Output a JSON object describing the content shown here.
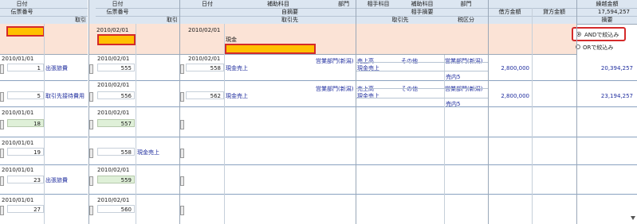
{
  "pane1": {
    "header": {
      "date": "日付",
      "slip_no": "伝票番号",
      "vendor_short": "取引"
    },
    "rows": [
      {
        "date": "2010/01/01",
        "no": "1",
        "desc": "出張旅費"
      },
      {
        "date": "",
        "no": "5",
        "desc": "取引先接待費用"
      },
      {
        "date": "2010/01/01",
        "no": "18",
        "desc": ""
      },
      {
        "date": "2010/01/01",
        "no": "19",
        "desc": ""
      },
      {
        "date": "2010/01/01",
        "no": "23",
        "desc": "出張旅費"
      },
      {
        "date": "2010/01/01",
        "no": "27",
        "desc": ""
      }
    ]
  },
  "pane2": {
    "header": {
      "date": "日付",
      "slip_no": "伝票番号",
      "vendor": "取引"
    },
    "filter_date": "2010/02/01",
    "rows": [
      {
        "date": "2010/02/01",
        "no": "555",
        "desc": ""
      },
      {
        "date": "2010/02/01",
        "no": "556",
        "desc": ""
      },
      {
        "date": "2010/02/01",
        "no": "557",
        "desc": ""
      },
      {
        "date": "",
        "no": "558",
        "desc": "現金売上"
      },
      {
        "date": "2010/02/01",
        "no": "559",
        "desc": ""
      },
      {
        "date": "2010/02/01",
        "no": "560",
        "desc": ""
      }
    ]
  },
  "pane3": {
    "header": {
      "date": "日付",
      "subaccount": "補助科目",
      "dept": "部門",
      "summary": "自摘要",
      "vendor": "取引先",
      "counter_account": "相手科目",
      "counter_subaccount": "補助科目",
      "counter_dept": "部門",
      "counter_summary": "相手摘要",
      "counter_vendor": "取引先",
      "tax_category": "税区分",
      "debit": "借方金額",
      "credit": "貸方金額",
      "balance": "繰越金額",
      "notes": "摘要",
      "carried_balance": "17,594,257"
    },
    "filter_date": "2010/02/01",
    "filter_account": "現金",
    "radio_and": "ANDで絞込み",
    "radio_or": "ORで絞込み",
    "rows": [
      {
        "date": "2010/02/01",
        "no": "558",
        "summary": "現金売上",
        "account": "売上高",
        "subaccount": "その他",
        "dept": "営業部門(新潟)",
        "counter_dept": "営業部門(新潟)",
        "counter_summary": "現金売上",
        "tax": "売内5",
        "debit": "2,800,000",
        "credit": "",
        "balance": "20,394,257"
      },
      {
        "date": "",
        "no": "562",
        "summary": "現金売上",
        "account": "売上高",
        "subaccount": "その他",
        "dept": "営業部門(新潟)",
        "counter_dept": "営業部門(新潟)",
        "counter_summary": "現金売上",
        "tax": "売内5",
        "debit": "2,800,000",
        "credit": "",
        "balance": "23,194,257"
      }
    ]
  }
}
